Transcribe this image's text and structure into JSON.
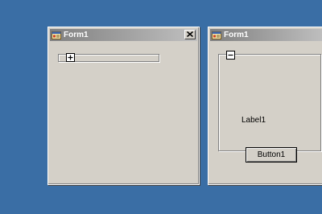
{
  "desktop": {
    "background_color": "#3a6ea5"
  },
  "windows": [
    {
      "title": "Form1",
      "has_close_button": true,
      "groupbox": {
        "state": "collapsed",
        "toggle_symbol": "plus"
      }
    },
    {
      "title": "Form1",
      "has_close_button": false,
      "groupbox": {
        "state": "expanded",
        "toggle_symbol": "minus",
        "label": "Label1",
        "button_label": "Button1"
      }
    }
  ],
  "icons": {
    "window_icon": "form-app-icon",
    "close": "close-icon",
    "expand": "plus-icon",
    "collapse": "minus-icon"
  },
  "colors": {
    "window_face": "#d4d0c8",
    "titlebar_inactive_start": "#808080",
    "titlebar_inactive_end": "#c0c0c0",
    "title_text": "#ffffff"
  }
}
